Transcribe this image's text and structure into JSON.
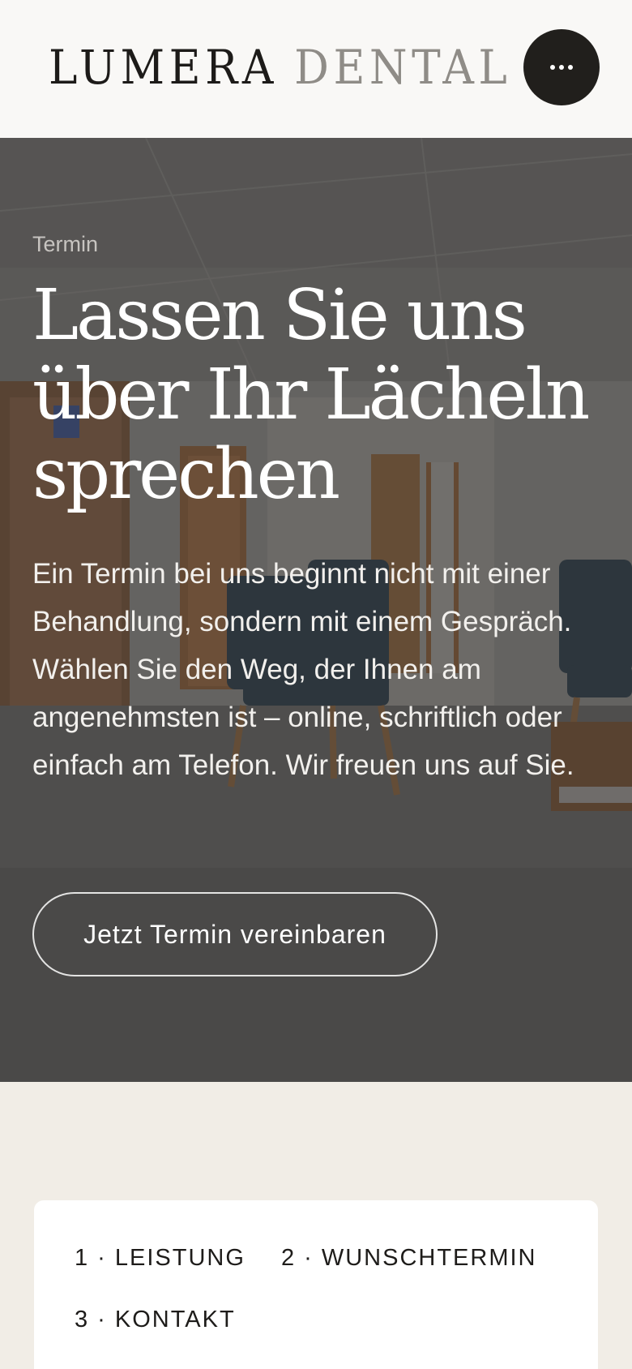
{
  "header": {
    "logo_primary": "LUMERA",
    "logo_secondary": "DENTAL",
    "menu_icon": "more-horizontal-icon"
  },
  "hero": {
    "eyebrow": "Termin",
    "title": "Lassen Sie uns über Ihr Lächeln sprechen",
    "body": "Ein Termin bei uns beginnt nicht mit einer Behandlung, sondern mit einem Gespräch. Wählen Sie den Weg, der Ihnen am angenehmsten ist – online, schriftlich oder einfach am Telefon. Wir freuen uns auf Sie.",
    "cta_label": "Jetzt Termin vereinbaren"
  },
  "booking": {
    "steps": [
      {
        "label": "1 · LEISTUNG"
      },
      {
        "label": "2 · WUNSCHTERMIN"
      },
      {
        "label": "3 · KONTAKT"
      }
    ]
  },
  "colors": {
    "header_bg": "#f9f8f6",
    "logo_dark": "#1d1b19",
    "logo_light": "#8f8c87",
    "menu_button": "#211f1c",
    "hero_overlay": "#565453",
    "section_bg": "#f1ede6",
    "card_bg": "#ffffff"
  }
}
